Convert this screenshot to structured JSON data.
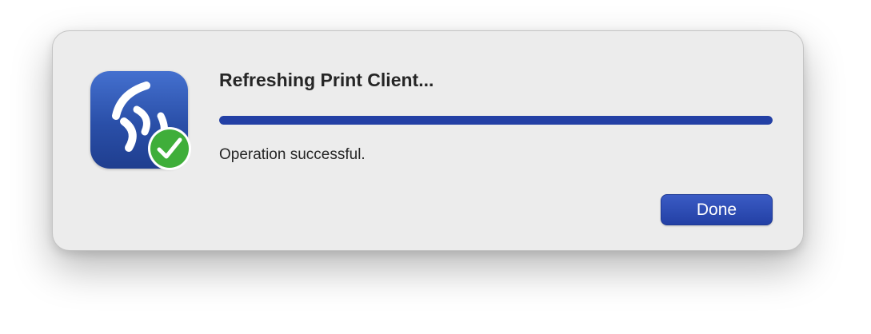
{
  "dialog": {
    "title": "Refreshing Print Client...",
    "status": "Operation successful.",
    "progress_fraction": 1.0,
    "done_label": "Done",
    "app_icon": "printer-client-logo-icon",
    "badge_icon": "checkmark-badge-icon"
  },
  "colors": {
    "dialog_background": "#ececec",
    "progress": "#2340a5",
    "button": "#2340a5",
    "icon_background": "#3459bf",
    "badge": "#3fae3a"
  }
}
